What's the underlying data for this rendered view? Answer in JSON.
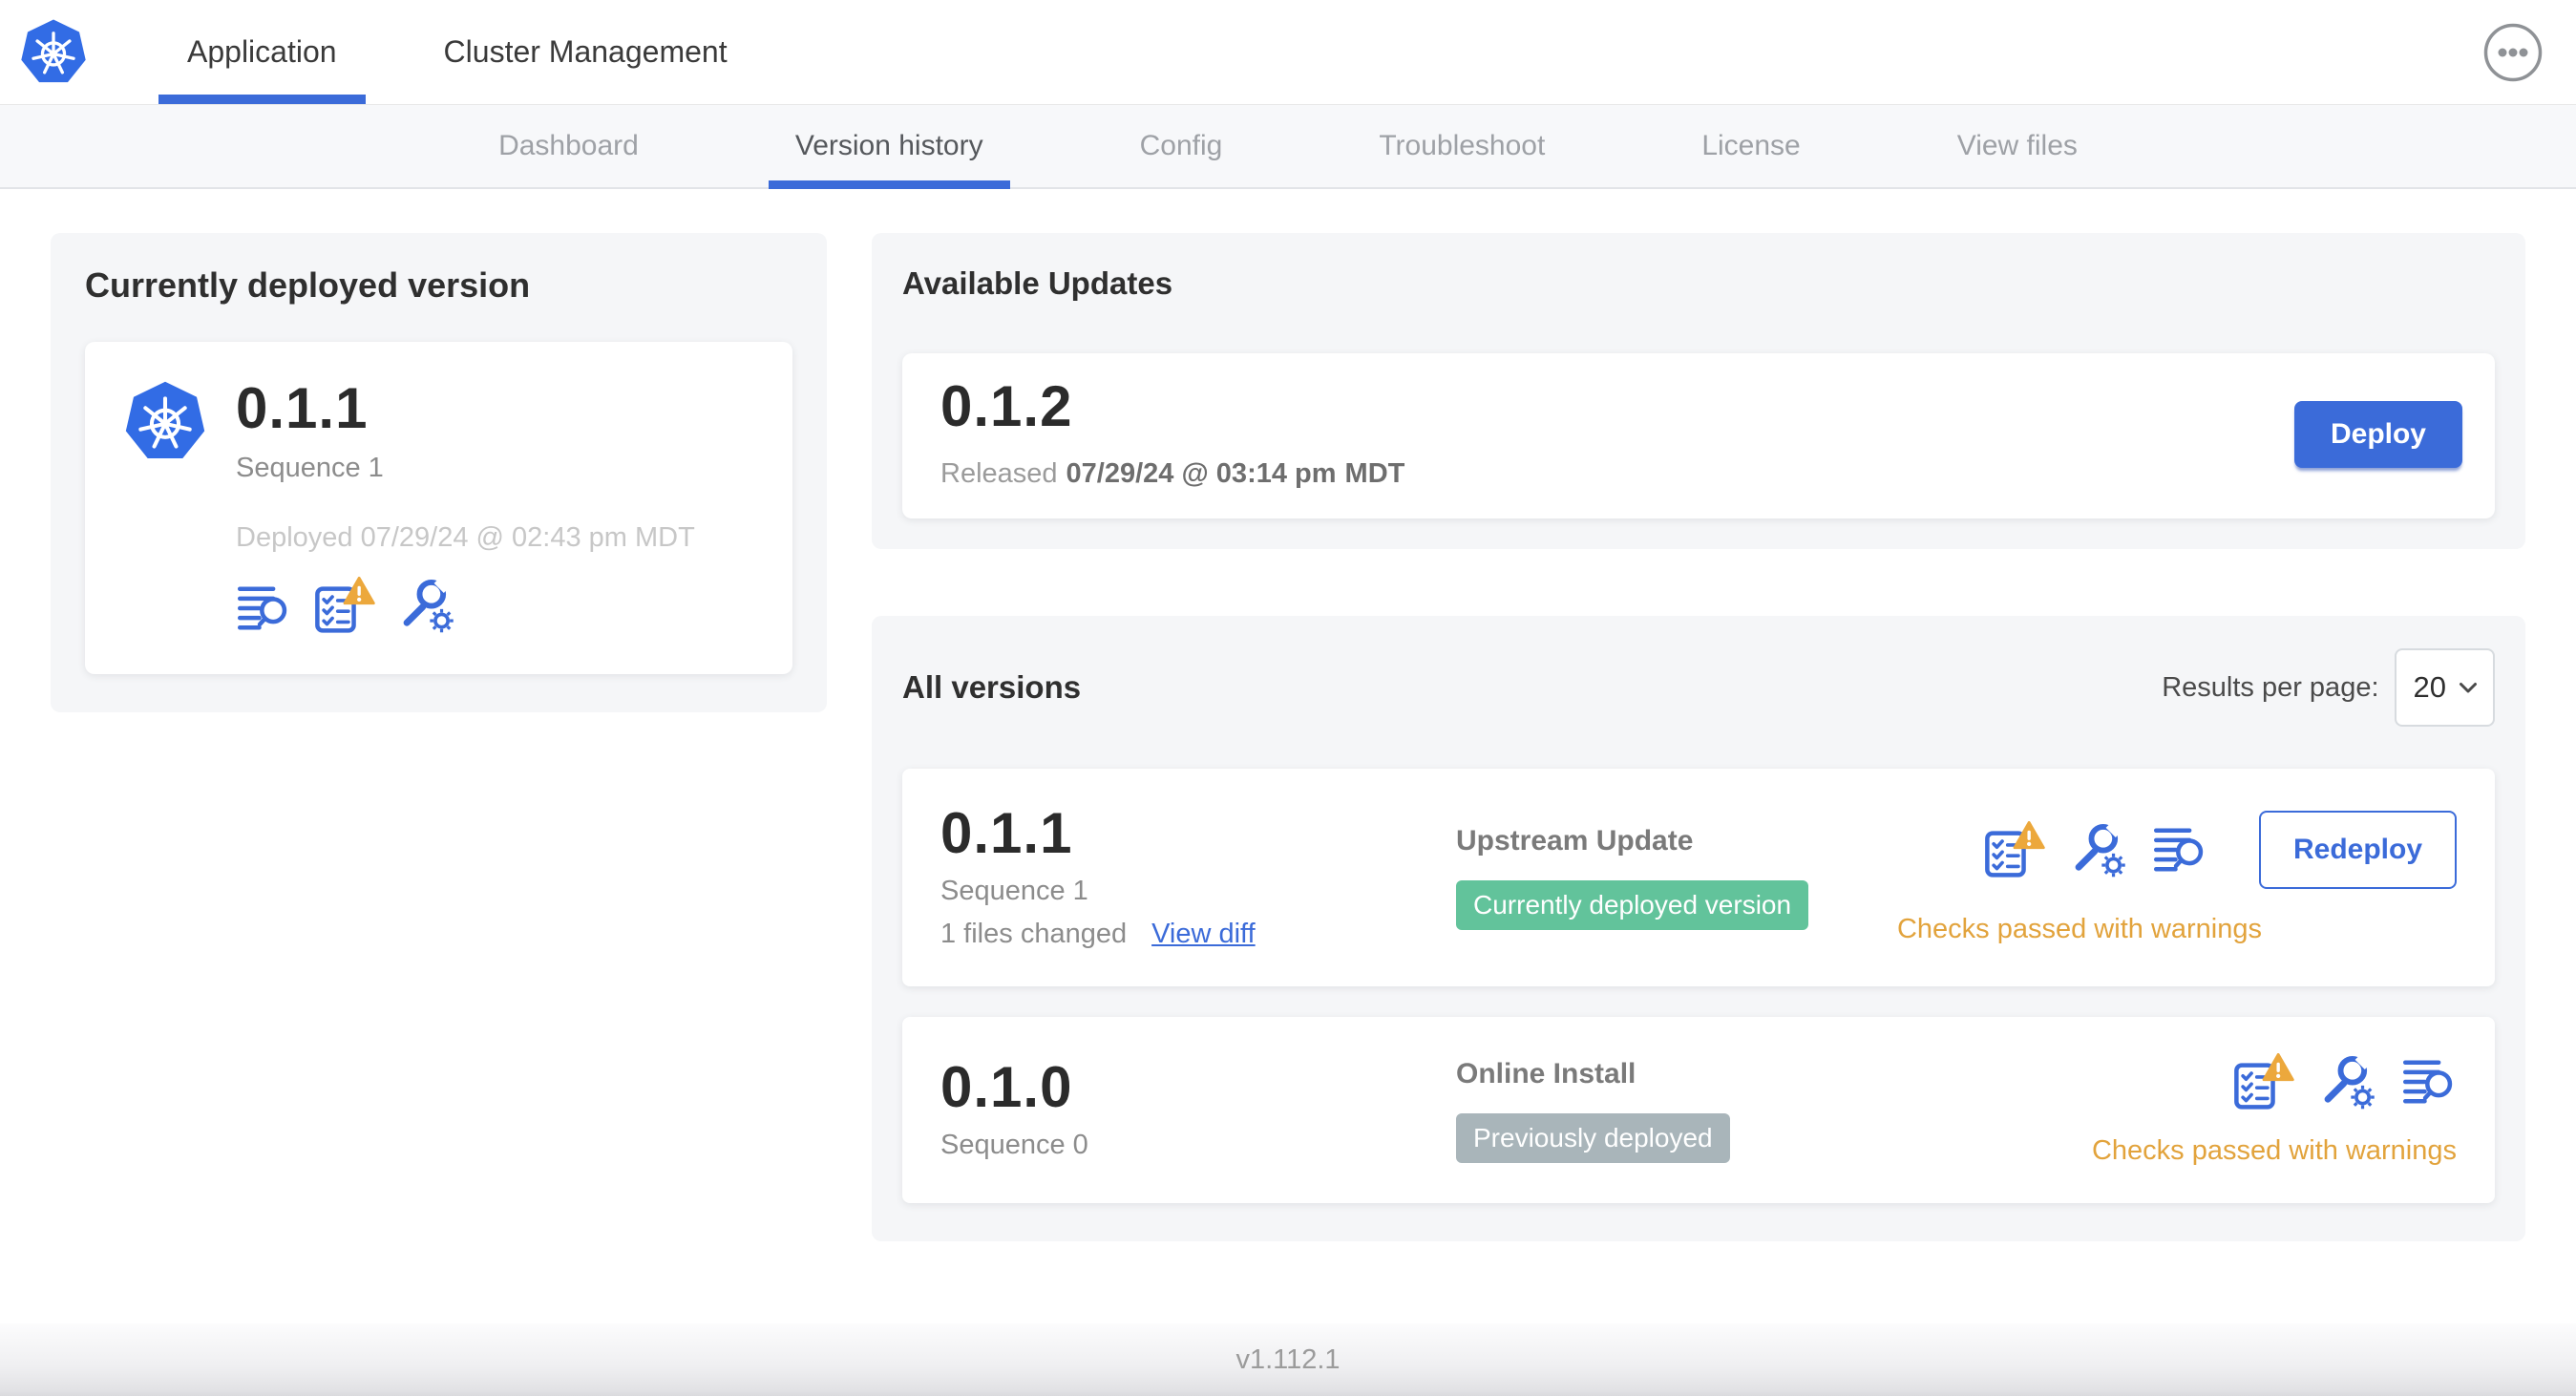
{
  "header": {
    "app_tabs": [
      {
        "label": "Application",
        "active": true
      },
      {
        "label": "Cluster Management",
        "active": false
      }
    ]
  },
  "subnav": {
    "tabs": [
      {
        "label": "Dashboard",
        "active": false
      },
      {
        "label": "Version history",
        "active": true
      },
      {
        "label": "Config",
        "active": false
      },
      {
        "label": "Troubleshoot",
        "active": false
      },
      {
        "label": "License",
        "active": false
      },
      {
        "label": "View files",
        "active": false
      }
    ]
  },
  "current_version": {
    "title": "Currently deployed version",
    "version": "0.1.1",
    "sequence": "Sequence 1",
    "deployed": "Deployed 07/29/24 @ 02:43 pm MDT"
  },
  "available_updates": {
    "title": "Available Updates",
    "version": "0.1.2",
    "released_prefix": "Released",
    "released_date": "07/29/24 @ 03:14 pm",
    "released_tz": "MDT",
    "deploy_label": "Deploy"
  },
  "all_versions": {
    "title": "All versions",
    "results_per_page_label": "Results per page:",
    "results_per_page_value": "20",
    "rows": [
      {
        "version": "0.1.1",
        "sequence": "Sequence 1",
        "files_changed": "1 files changed",
        "view_diff_label": "View diff",
        "source": "Upstream Update",
        "badge_label": "Currently deployed version",
        "status": "Checks passed with warnings",
        "action_label": "Redeploy"
      },
      {
        "version": "0.1.0",
        "sequence": "Sequence 0",
        "source": "Online Install",
        "badge_label": "Previously deployed",
        "status": "Checks passed with warnings"
      }
    ]
  },
  "footer": {
    "version": "v1.112.1"
  },
  "icons": {
    "logs": "logs-icon",
    "preflight": "preflight-checks-icon",
    "warning": "warning-triangle-icon",
    "config": "wrench-gear-icon",
    "more": "ellipsis-icon",
    "logo": "kubernetes-logo",
    "chevron": "chevron-down-icon"
  },
  "colors": {
    "accent_blue": "#3B6BD9",
    "kubernetes_blue": "#326CE5",
    "badge_green": "#62C39B",
    "badge_gray": "#A9B5BA",
    "warning_amber": "#E2A33C",
    "card_background": "#F5F6F8"
  }
}
